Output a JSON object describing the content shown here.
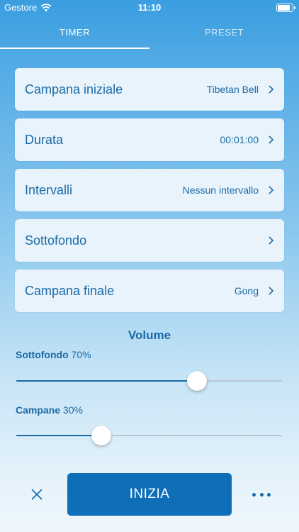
{
  "status_bar": {
    "carrier": "Gestore",
    "time": "11:10",
    "battery_level": 0.9
  },
  "tabs": [
    {
      "label": "TIMER",
      "active": true
    },
    {
      "label": "PRESET",
      "active": false
    }
  ],
  "settings": [
    {
      "label": "Campana iniziale",
      "value": "Tibetan Bell"
    },
    {
      "label": "Durata",
      "value": "00:01:00"
    },
    {
      "label": "Intervalli",
      "value": "Nessun intervallo"
    },
    {
      "label": "Sottofondo",
      "value": ""
    },
    {
      "label": "Campana finale",
      "value": "Gong"
    }
  ],
  "volume": {
    "title": "Volume",
    "background": {
      "name": "Sottofondo",
      "percent_text": "70%",
      "level": 0.68
    },
    "bells": {
      "name": "Campane",
      "percent_text": "30%",
      "level": 0.32
    }
  },
  "actions": {
    "start_label": "INIZIA"
  },
  "colors": {
    "accent": "#1c6aa6",
    "button": "#0e6eb8",
    "card": "#e8f3fb",
    "track": "#b9c8d4"
  },
  "icons": {
    "close": "close-icon",
    "more": "more-icon",
    "chevron": "chevron-right-icon",
    "wifi": "wifi-icon",
    "battery": "battery-icon"
  }
}
